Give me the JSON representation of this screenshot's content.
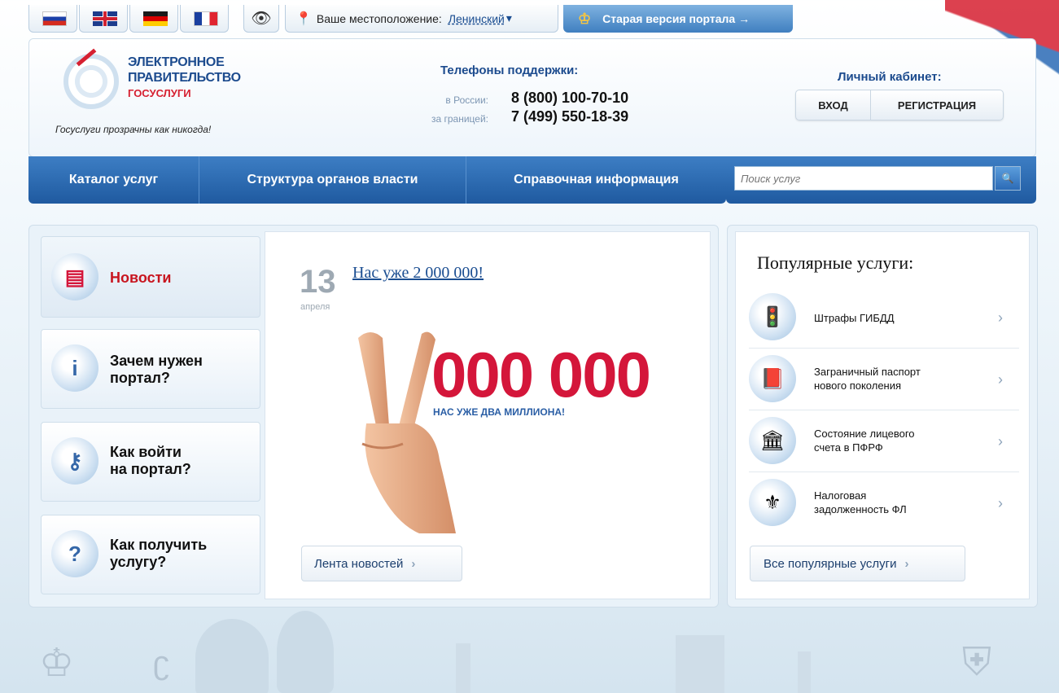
{
  "topbar": {
    "location_label": "Ваше местоположение:",
    "location_value": "Ленинский",
    "old_version": "Старая версия портала →"
  },
  "header": {
    "logo_line1": "ЭЛЕКТРОННОЕ",
    "logo_line2": "ПРАВИТЕЛЬСТВО",
    "logo_line3": "ГОСУСЛУГИ",
    "slogan": "Госуслуги прозрачны как никогда!",
    "support_title": "Телефоны поддержки:",
    "phone_russia_label": "в России:",
    "phone_russia": "8 (800) 100-70-10",
    "phone_abroad_label": "за границей:",
    "phone_abroad": "7 (499) 550-18-39",
    "cabinet_title": "Личный кабинет:",
    "login": "ВХОД",
    "register": "РЕГИСТРАЦИЯ"
  },
  "nav": {
    "catalog": "Каталог услуг",
    "structure": "Структура органов власти",
    "reference": "Справочная информация",
    "search_placeholder": "Поиск услуг"
  },
  "tabs": [
    {
      "label_1": "Новости",
      "label_2": "",
      "icon": "newspaper-icon"
    },
    {
      "label_1": "Зачем нужен",
      "label_2": "портал?",
      "icon": "info-icon"
    },
    {
      "label_1": "Как войти",
      "label_2": "на портал?",
      "icon": "key-icon"
    },
    {
      "label_1": "Как получить",
      "label_2": "услугу?",
      "icon": "question-icon"
    }
  ],
  "news": {
    "day": "13",
    "month": "апреля",
    "headline": "Нас уже 2 000 000!",
    "promo_number": "000 000",
    "promo_sub": "НАС УЖЕ ДВА МИЛЛИОНА!",
    "feed_button": "Лента новостей"
  },
  "popular": {
    "title": "Популярные услуги:",
    "items": [
      {
        "line1": "Штрафы ГИБДД",
        "line2": "",
        "icon": "traffic-light-icon"
      },
      {
        "line1": "Заграничный паспорт",
        "line2": "нового поколения",
        "icon": "passport-icon"
      },
      {
        "line1": "Состояние лицевого",
        "line2": "счета в ПФРФ",
        "icon": "pension-fund-icon"
      },
      {
        "line1": "Налоговая",
        "line2": "задолженность ФЛ",
        "icon": "tax-emblem-icon"
      }
    ],
    "all_button": "Все популярные услуги"
  },
  "colors": {
    "brand_blue": "#1f5aa0",
    "brand_red": "#d4163a"
  }
}
